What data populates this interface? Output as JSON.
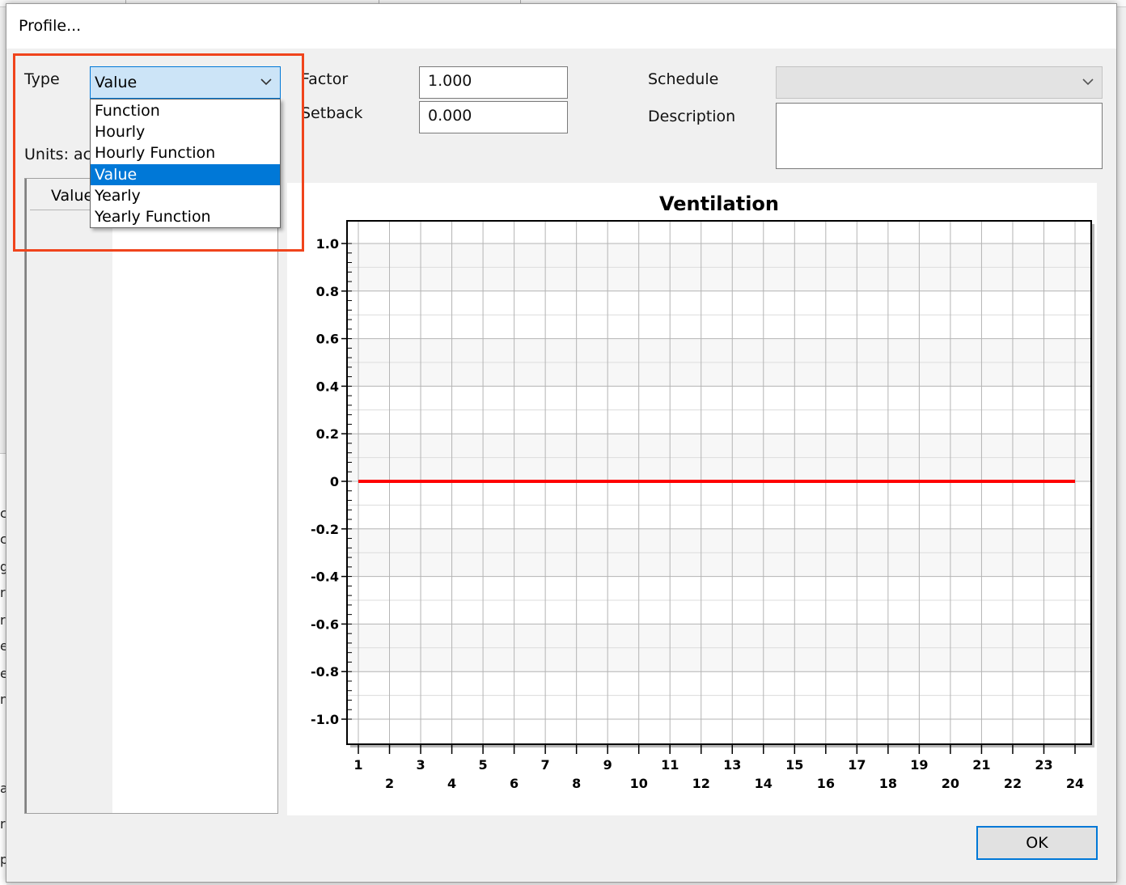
{
  "background_window": {
    "left_strip_chars": [
      "c",
      "c",
      "g",
      "r",
      "r",
      "e",
      "e",
      "n",
      "a",
      "r",
      "p"
    ]
  },
  "dialog": {
    "title": "Profile..."
  },
  "form": {
    "type_label": "Type",
    "type_selected": "Value",
    "type_options": [
      "Function",
      "Hourly",
      "Hourly Function",
      "Value",
      "Yearly",
      "Yearly Function"
    ],
    "factor_label": "Factor",
    "factor_value": "1.000",
    "setback_label": "Setback",
    "setback_value": "0.000",
    "schedule_label": "Schedule",
    "schedule_value": "",
    "description_label": "Description",
    "description_value": "",
    "units_label": "Units: ac"
  },
  "grid": {
    "value_header": "Value"
  },
  "chart_data": {
    "type": "line",
    "title": "Ventilation",
    "xlabel": "",
    "ylabel": "",
    "x": [
      1,
      2,
      3,
      4,
      5,
      6,
      7,
      8,
      9,
      10,
      11,
      12,
      13,
      14,
      15,
      16,
      17,
      18,
      19,
      20,
      21,
      22,
      23,
      24
    ],
    "series": [
      {
        "values": [
          0,
          0,
          0,
          0,
          0,
          0,
          0,
          0,
          0,
          0,
          0,
          0,
          0,
          0,
          0,
          0,
          0,
          0,
          0,
          0,
          0,
          0,
          0,
          0
        ],
        "color": "#ff0000"
      }
    ],
    "xlim": [
      1,
      24
    ],
    "ylim": [
      -1.0,
      1.0
    ],
    "yticks": [
      "1.0",
      "0.8",
      "0.6",
      "0.4",
      "0.2",
      "0",
      "-0.2",
      "-0.4",
      "-0.6",
      "-0.8",
      "-1.0"
    ],
    "xticks": [
      "1",
      "2",
      "3",
      "4",
      "5",
      "6",
      "7",
      "8",
      "9",
      "10",
      "11",
      "12",
      "13",
      "14",
      "15",
      "16",
      "17",
      "18",
      "19",
      "20",
      "21",
      "22",
      "23",
      "24"
    ],
    "grid": true
  },
  "buttons": {
    "ok_label": "OK"
  },
  "colors": {
    "accent": "#0078d7",
    "highlight": "#f0441c",
    "series": "#ff0000"
  }
}
